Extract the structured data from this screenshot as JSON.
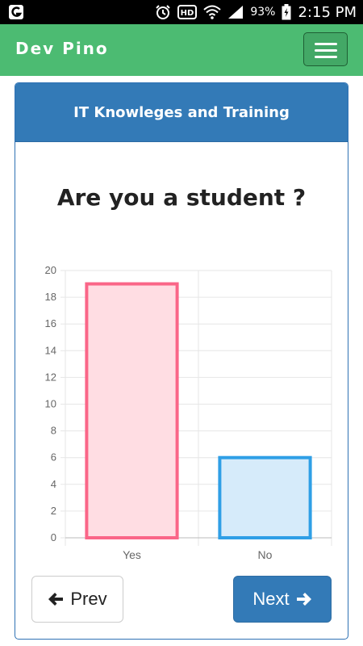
{
  "status_bar": {
    "battery": "93%",
    "time": "2:15 PM",
    "icons": [
      "app-notification-icon",
      "alarm-icon",
      "hd-icon",
      "wifi-icon",
      "signal-icon",
      "battery-icon"
    ]
  },
  "navbar": {
    "brand": "Dev Pino",
    "menu_icon": "hamburger-icon",
    "color": "#4cbb72"
  },
  "card": {
    "header_title": "IT Knowleges and Training",
    "header_color": "#337ab7"
  },
  "question": "Are you a student ?",
  "chart_data": {
    "type": "bar",
    "categories": [
      "Yes",
      "No"
    ],
    "values": [
      19,
      6
    ],
    "ylim": [
      0,
      20
    ],
    "yticks": [
      0,
      2,
      4,
      6,
      8,
      10,
      12,
      14,
      16,
      18,
      20
    ],
    "grid": true,
    "colors": [
      {
        "fill": "#ffdde3",
        "stroke": "#fa6688"
      },
      {
        "fill": "#d6ebfa",
        "stroke": "#2f9fe6"
      }
    ]
  },
  "buttons": {
    "prev": "Prev",
    "next": "Next",
    "prev_icon": "arrow-left-icon",
    "next_icon": "arrow-right-icon"
  }
}
